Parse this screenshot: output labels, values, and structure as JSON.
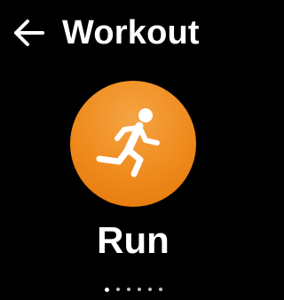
{
  "header": {
    "back_icon": "arrow-left-icon",
    "title": "Workout"
  },
  "activity": {
    "icon": "running-person-icon",
    "label": "Run",
    "accent_color": "#ef8a1c"
  },
  "pagination": {
    "total": 6,
    "active_index": 0
  }
}
